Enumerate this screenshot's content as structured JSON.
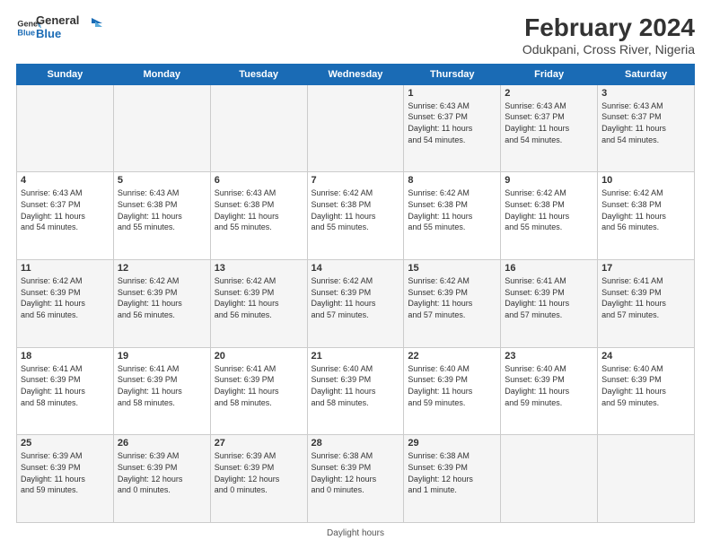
{
  "header": {
    "logo_line1": "General",
    "logo_line2": "Blue",
    "title": "February 2024",
    "subtitle": "Odukpani, Cross River, Nigeria"
  },
  "days_of_week": [
    "Sunday",
    "Monday",
    "Tuesday",
    "Wednesday",
    "Thursday",
    "Friday",
    "Saturday"
  ],
  "footer": "Daylight hours",
  "weeks": [
    [
      {
        "day": "",
        "info": ""
      },
      {
        "day": "",
        "info": ""
      },
      {
        "day": "",
        "info": ""
      },
      {
        "day": "",
        "info": ""
      },
      {
        "day": "1",
        "info": "Sunrise: 6:43 AM\nSunset: 6:37 PM\nDaylight: 11 hours\nand 54 minutes."
      },
      {
        "day": "2",
        "info": "Sunrise: 6:43 AM\nSunset: 6:37 PM\nDaylight: 11 hours\nand 54 minutes."
      },
      {
        "day": "3",
        "info": "Sunrise: 6:43 AM\nSunset: 6:37 PM\nDaylight: 11 hours\nand 54 minutes."
      }
    ],
    [
      {
        "day": "4",
        "info": "Sunrise: 6:43 AM\nSunset: 6:37 PM\nDaylight: 11 hours\nand 54 minutes."
      },
      {
        "day": "5",
        "info": "Sunrise: 6:43 AM\nSunset: 6:38 PM\nDaylight: 11 hours\nand 55 minutes."
      },
      {
        "day": "6",
        "info": "Sunrise: 6:43 AM\nSunset: 6:38 PM\nDaylight: 11 hours\nand 55 minutes."
      },
      {
        "day": "7",
        "info": "Sunrise: 6:42 AM\nSunset: 6:38 PM\nDaylight: 11 hours\nand 55 minutes."
      },
      {
        "day": "8",
        "info": "Sunrise: 6:42 AM\nSunset: 6:38 PM\nDaylight: 11 hours\nand 55 minutes."
      },
      {
        "day": "9",
        "info": "Sunrise: 6:42 AM\nSunset: 6:38 PM\nDaylight: 11 hours\nand 55 minutes."
      },
      {
        "day": "10",
        "info": "Sunrise: 6:42 AM\nSunset: 6:38 PM\nDaylight: 11 hours\nand 56 minutes."
      }
    ],
    [
      {
        "day": "11",
        "info": "Sunrise: 6:42 AM\nSunset: 6:39 PM\nDaylight: 11 hours\nand 56 minutes."
      },
      {
        "day": "12",
        "info": "Sunrise: 6:42 AM\nSunset: 6:39 PM\nDaylight: 11 hours\nand 56 minutes."
      },
      {
        "day": "13",
        "info": "Sunrise: 6:42 AM\nSunset: 6:39 PM\nDaylight: 11 hours\nand 56 minutes."
      },
      {
        "day": "14",
        "info": "Sunrise: 6:42 AM\nSunset: 6:39 PM\nDaylight: 11 hours\nand 57 minutes."
      },
      {
        "day": "15",
        "info": "Sunrise: 6:42 AM\nSunset: 6:39 PM\nDaylight: 11 hours\nand 57 minutes."
      },
      {
        "day": "16",
        "info": "Sunrise: 6:41 AM\nSunset: 6:39 PM\nDaylight: 11 hours\nand 57 minutes."
      },
      {
        "day": "17",
        "info": "Sunrise: 6:41 AM\nSunset: 6:39 PM\nDaylight: 11 hours\nand 57 minutes."
      }
    ],
    [
      {
        "day": "18",
        "info": "Sunrise: 6:41 AM\nSunset: 6:39 PM\nDaylight: 11 hours\nand 58 minutes."
      },
      {
        "day": "19",
        "info": "Sunrise: 6:41 AM\nSunset: 6:39 PM\nDaylight: 11 hours\nand 58 minutes."
      },
      {
        "day": "20",
        "info": "Sunrise: 6:41 AM\nSunset: 6:39 PM\nDaylight: 11 hours\nand 58 minutes."
      },
      {
        "day": "21",
        "info": "Sunrise: 6:40 AM\nSunset: 6:39 PM\nDaylight: 11 hours\nand 58 minutes."
      },
      {
        "day": "22",
        "info": "Sunrise: 6:40 AM\nSunset: 6:39 PM\nDaylight: 11 hours\nand 59 minutes."
      },
      {
        "day": "23",
        "info": "Sunrise: 6:40 AM\nSunset: 6:39 PM\nDaylight: 11 hours\nand 59 minutes."
      },
      {
        "day": "24",
        "info": "Sunrise: 6:40 AM\nSunset: 6:39 PM\nDaylight: 11 hours\nand 59 minutes."
      }
    ],
    [
      {
        "day": "25",
        "info": "Sunrise: 6:39 AM\nSunset: 6:39 PM\nDaylight: 11 hours\nand 59 minutes."
      },
      {
        "day": "26",
        "info": "Sunrise: 6:39 AM\nSunset: 6:39 PM\nDaylight: 12 hours\nand 0 minutes."
      },
      {
        "day": "27",
        "info": "Sunrise: 6:39 AM\nSunset: 6:39 PM\nDaylight: 12 hours\nand 0 minutes."
      },
      {
        "day": "28",
        "info": "Sunrise: 6:38 AM\nSunset: 6:39 PM\nDaylight: 12 hours\nand 0 minutes."
      },
      {
        "day": "29",
        "info": "Sunrise: 6:38 AM\nSunset: 6:39 PM\nDaylight: 12 hours\nand 1 minute."
      },
      {
        "day": "",
        "info": ""
      },
      {
        "day": "",
        "info": ""
      }
    ]
  ]
}
